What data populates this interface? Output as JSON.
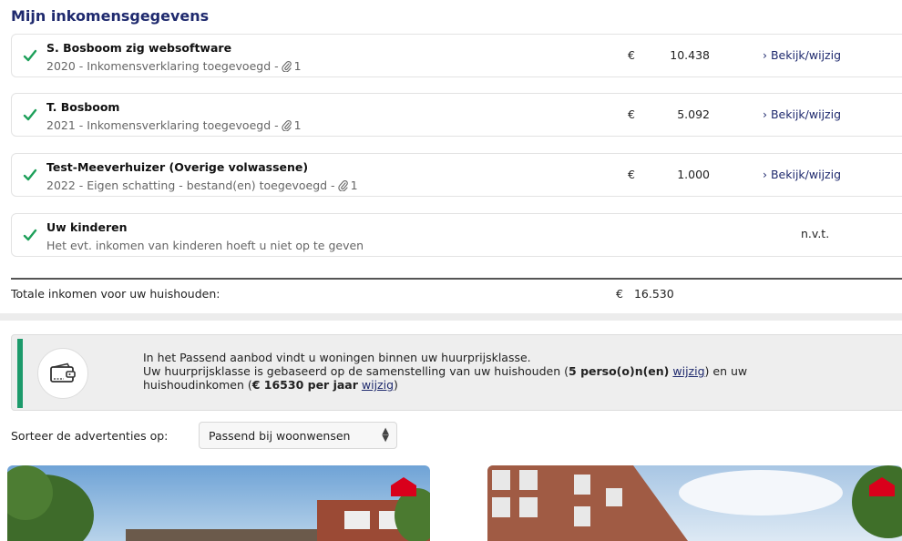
{
  "section": {
    "title": "Mijn inkomensgegevens"
  },
  "income_items": [
    {
      "name": "S. Bosboom zig websoftware",
      "subtitle": "2020 - Inkomensverklaring toegevoegd -",
      "attachments": "1",
      "currency": "€",
      "amount": "10.438",
      "action": "› Bekijk/wijzig"
    },
    {
      "name": "T. Bosboom",
      "subtitle": "2021 - Inkomensverklaring toegevoegd -",
      "attachments": "1",
      "currency": "€",
      "amount": "5.092",
      "action": "› Bekijk/wijzig"
    },
    {
      "name": "Test-Meeverhuizer (Overige volwassene)",
      "subtitle": "2022 - Eigen schatting - bestand(en) toegevoegd -",
      "attachments": "1",
      "currency": "€",
      "amount": "1.000",
      "action": "› Bekijk/wijzig"
    },
    {
      "name": "Uw kinderen",
      "subtitle": "Het evt. inkomen van kinderen hoeft u niet op te geven",
      "status": "n.v.t."
    }
  ],
  "total": {
    "label": "Totale inkomen voor uw huishouden:",
    "currency": "€",
    "amount": "16.530"
  },
  "info": {
    "line1": "In het Passend aanbod vindt u woningen binnen uw huurprijsklasse.",
    "line2_a": "Uw huurprijsklasse is gebaseerd op de samenstelling van uw huishouden (",
    "line2_bold": "5 perso(o)n(en)",
    "line2_link": "wijzig",
    "line2_b": ") en uw",
    "line3_a": "huishoudinkomen (",
    "line3_bold": "€ 16530 per jaar",
    "line3_link": "wijzig",
    "line3_b": ")"
  },
  "sort": {
    "label": "Sorteer de advertenties op:",
    "value": "Passend bij woonwensen"
  },
  "colors": {
    "accent": "#1f2a6e",
    "check": "#1ea05a",
    "info_bar": "#1c9a6b",
    "badge": "#d9001b"
  }
}
